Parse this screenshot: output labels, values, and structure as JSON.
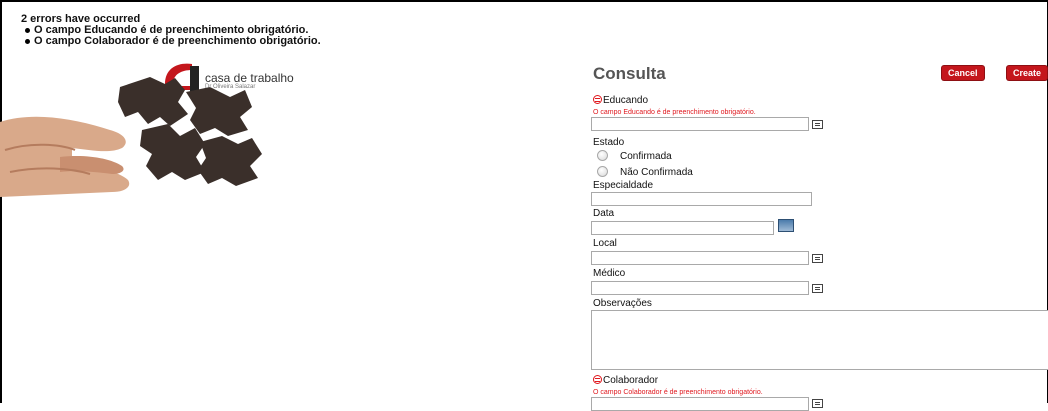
{
  "errors": {
    "header": "2 errors have occurred",
    "items": [
      "O campo Educando é de preenchimento obrigatório.",
      "O campo Colaborador é de preenchimento obrigatório."
    ]
  },
  "brand": {
    "name": "casa de trabalho",
    "subtitle": "Dr Oliveira Salazar"
  },
  "form": {
    "title": "Consulta",
    "buttons": {
      "cancel": "Cancel",
      "create": "Create"
    },
    "educando": {
      "label": "Educando",
      "error": "O campo Educando é de preenchimento obrigatório.",
      "value": ""
    },
    "estado": {
      "label": "Estado",
      "options": [
        "Confirmada",
        "Não Confirmada"
      ]
    },
    "especialidade": {
      "label": "Especialdade",
      "value": ""
    },
    "data": {
      "label": "Data",
      "value": ""
    },
    "local": {
      "label": "Local",
      "value": ""
    },
    "medico": {
      "label": "Médico",
      "value": ""
    },
    "observacoes": {
      "label": "Observações",
      "value": ""
    },
    "colaborador": {
      "label": "Colaborador",
      "error": "O campo Colaborador é de preenchimento obrigatório.",
      "value": ""
    }
  },
  "colors": {
    "accent": "#c4161c",
    "error": "#e0191f"
  }
}
